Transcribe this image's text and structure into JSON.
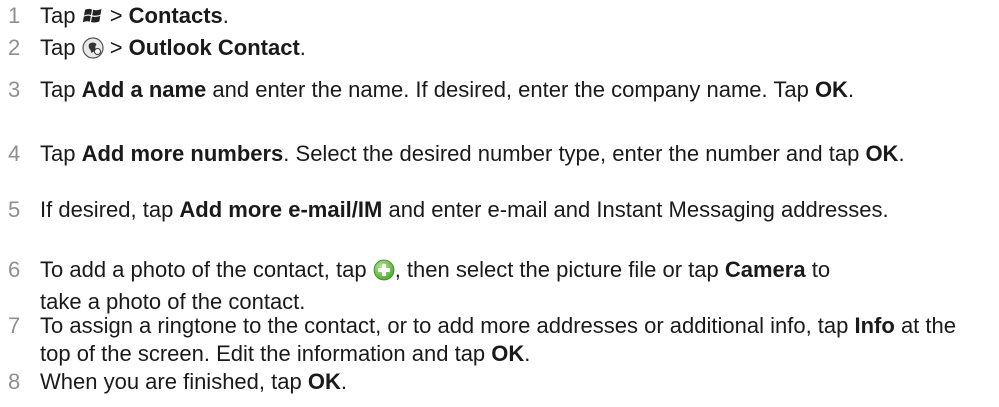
{
  "steps": [
    {
      "num": "1",
      "parts": {
        "a": "Tap ",
        "icon": "windows-start-icon",
        "b": " > ",
        "c": "Contacts",
        "d": "."
      }
    },
    {
      "num": "2",
      "parts": {
        "a": "Tap ",
        "icon": "new-contact-menu-icon",
        "b": " > ",
        "c": "Outlook Contact",
        "d": "."
      }
    },
    {
      "num": "3",
      "parts": {
        "a": "Tap ",
        "b": "Add a name",
        "c": " and enter the name. If desired, enter the company name. Tap ",
        "d": "OK",
        "e": "."
      }
    },
    {
      "num": "4",
      "parts": {
        "a": "Tap ",
        "b": "Add more numbers",
        "c": ". Select the desired number type, enter the number and tap ",
        "d": "OK",
        "e": "."
      }
    },
    {
      "num": "5",
      "parts": {
        "a": "If desired, tap ",
        "b": "Add more e-mail/IM",
        "c": " and enter e-mail and Instant Messaging addresses."
      }
    },
    {
      "num": "6",
      "parts": {
        "a": "To add a photo of the contact, tap ",
        "icon": "add-photo-plus-icon",
        "b": ", then select the picture file or tap ",
        "c": "Camera",
        "d": " to",
        "e": "take a photo of the contact."
      }
    },
    {
      "num": "7",
      "parts": {
        "a": "To assign a ringtone to the contact, or to add more addresses or additional info, tap ",
        "b": "Info",
        "c": " at the top of the screen. Edit the information and tap ",
        "d": "OK",
        "e": "."
      }
    },
    {
      "num": "8",
      "parts": {
        "a": "When you are finished, tap ",
        "b": "OK",
        "c": "."
      }
    }
  ],
  "colors": {
    "step_number": "#8f8f8f",
    "text": "#1a1a1a",
    "plus_icon": "#5cb83a"
  }
}
